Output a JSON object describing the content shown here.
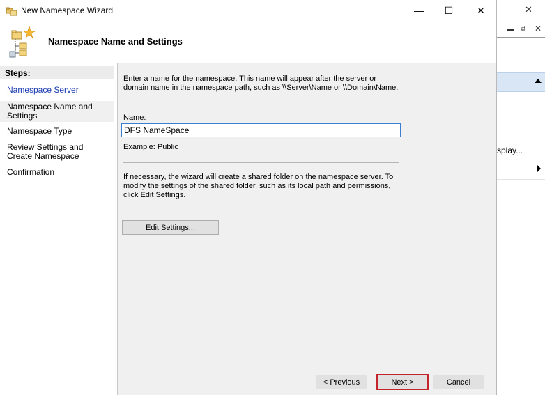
{
  "window": {
    "title": "New Namespace Wizard",
    "minimize_symbol": "—",
    "maximize_symbol": "☐",
    "close_symbol": "✕"
  },
  "header": {
    "title": "Namespace Name and Settings",
    "icon": "namespace-wizard-icon"
  },
  "steps": {
    "label": "Steps:",
    "items": [
      {
        "label": "Namespace Server",
        "state": "link"
      },
      {
        "label": "Namespace Name and Settings",
        "state": "current"
      },
      {
        "label": "Namespace Type",
        "state": "normal"
      },
      {
        "label": "Review Settings and Create Namespace",
        "state": "normal"
      },
      {
        "label": "Confirmation",
        "state": "normal"
      }
    ]
  },
  "content": {
    "description": "Enter a name for the namespace. This name will appear after the server or domain name in the namespace path, such as \\\\Server\\Name or \\\\Domain\\Name.",
    "name_label": "Name:",
    "name_value": "DFS NameSpace",
    "example": "Example: Public",
    "note": "If necessary, the wizard will create a shared folder on the namespace server. To modify the settings of the shared folder, such as its local path and permissions, click Edit Settings.",
    "edit_settings_label": "Edit Settings..."
  },
  "footer": {
    "previous_label": "< Previous",
    "next_label": "Next >",
    "cancel_label": "Cancel"
  },
  "background_window": {
    "close_symbol": "✕",
    "partial_text": "splay...",
    "selected_row_color": "#d9e6f5"
  },
  "colors": {
    "link": "#1a3bb0",
    "focus_border": "#3c7fd1",
    "highlight_border": "#c4242c"
  }
}
